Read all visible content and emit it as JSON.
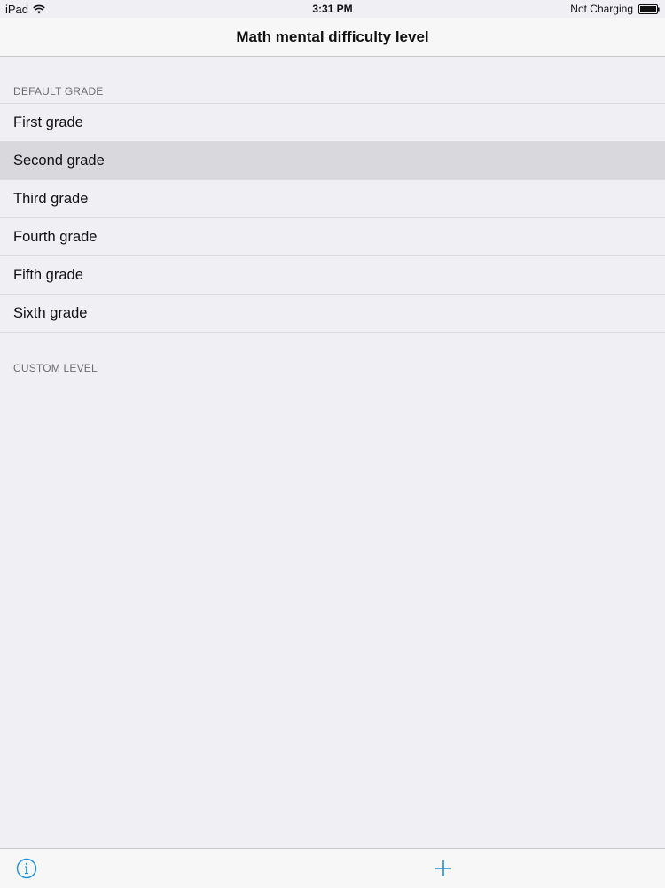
{
  "status_bar": {
    "device": "iPad",
    "time": "3:31 PM",
    "battery_status": "Not Charging",
    "icons": [
      "wifi-icon",
      "battery-icon"
    ]
  },
  "nav": {
    "title": "Math mental difficulty level"
  },
  "sections": {
    "default": {
      "header": "DEFAULT GRADE",
      "items": [
        {
          "label": "First grade",
          "selected": false
        },
        {
          "label": "Second grade",
          "selected": true
        },
        {
          "label": "Third grade",
          "selected": false
        },
        {
          "label": "Fourth grade",
          "selected": false
        },
        {
          "label": "Fifth grade",
          "selected": false
        },
        {
          "label": "Sixth grade",
          "selected": false
        }
      ]
    },
    "custom": {
      "header": "CUSTOM LEVEL"
    }
  },
  "toolbar": {
    "icons": [
      "info-icon",
      "plus-icon"
    ]
  },
  "colors": {
    "background": "#efeff4",
    "selected_row": "#d9d9dd",
    "tint": "#1a8fdc",
    "section_header_text": "#6d6d72"
  }
}
